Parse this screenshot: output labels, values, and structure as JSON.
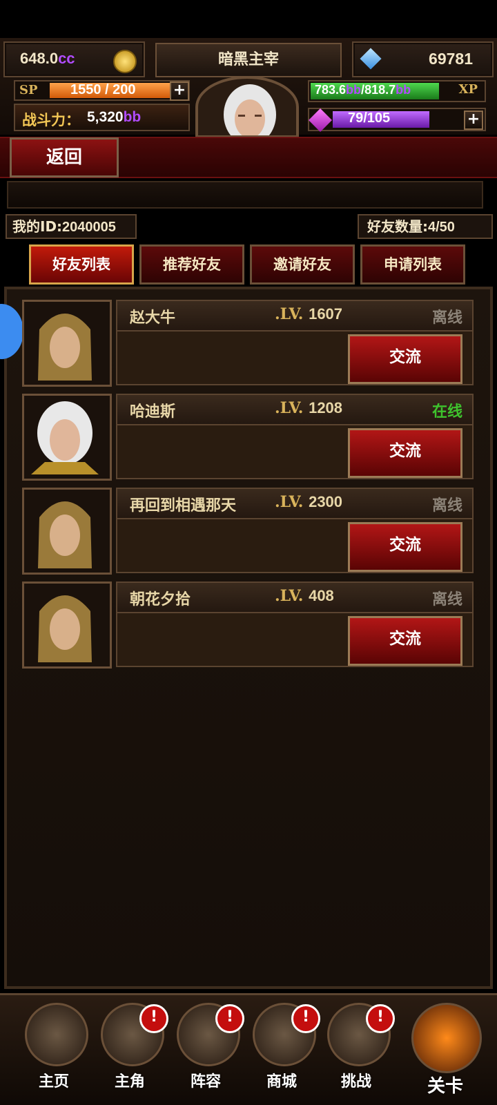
{
  "header": {
    "gold": "648.0",
    "gold_unit": "cc",
    "title": "暗黑主宰",
    "diamonds": "69781",
    "sp_label": "SP",
    "sp_value": "1550 / 200",
    "power_label": "战斗力：",
    "power_value": "5,320",
    "power_unit": "bb",
    "xp_current": "783.6",
    "xp_max": "818.7",
    "xp_unit": "bb",
    "xp_label": "XP",
    "gem_value": "79/105",
    "plus": "+"
  },
  "back_label": "返回",
  "my_id_label": "我的ID:",
  "my_id_value": "2040005",
  "friend_count_label": "好友数量:",
  "friend_count_value": "4/50",
  "tabs": [
    "好友列表",
    "推荐好友",
    "邀请好友",
    "申请列表"
  ],
  "lv_tag": ".LV.",
  "chat_label": "交流",
  "friends": [
    {
      "name": "赵大牛",
      "level": "1607",
      "status": "离线"
    },
    {
      "name": "哈迪斯",
      "level": "1208",
      "status": "在线"
    },
    {
      "name": "再回到相遇那天",
      "level": "2300",
      "status": "离线"
    },
    {
      "name": "朝花夕拾",
      "level": "408",
      "status": "离线"
    }
  ],
  "nav": [
    {
      "label": "主页",
      "alert": false
    },
    {
      "label": "主角",
      "alert": true
    },
    {
      "label": "阵容",
      "alert": true
    },
    {
      "label": "商城",
      "alert": true
    },
    {
      "label": "挑战",
      "alert": true
    },
    {
      "label": "关卡",
      "alert": false
    }
  ],
  "alert_mark": "!",
  "colors": {
    "accent_red": "#b21616",
    "online": "#3ec32d",
    "offline": "#8c8378",
    "gold_text": "#d9b35b"
  }
}
